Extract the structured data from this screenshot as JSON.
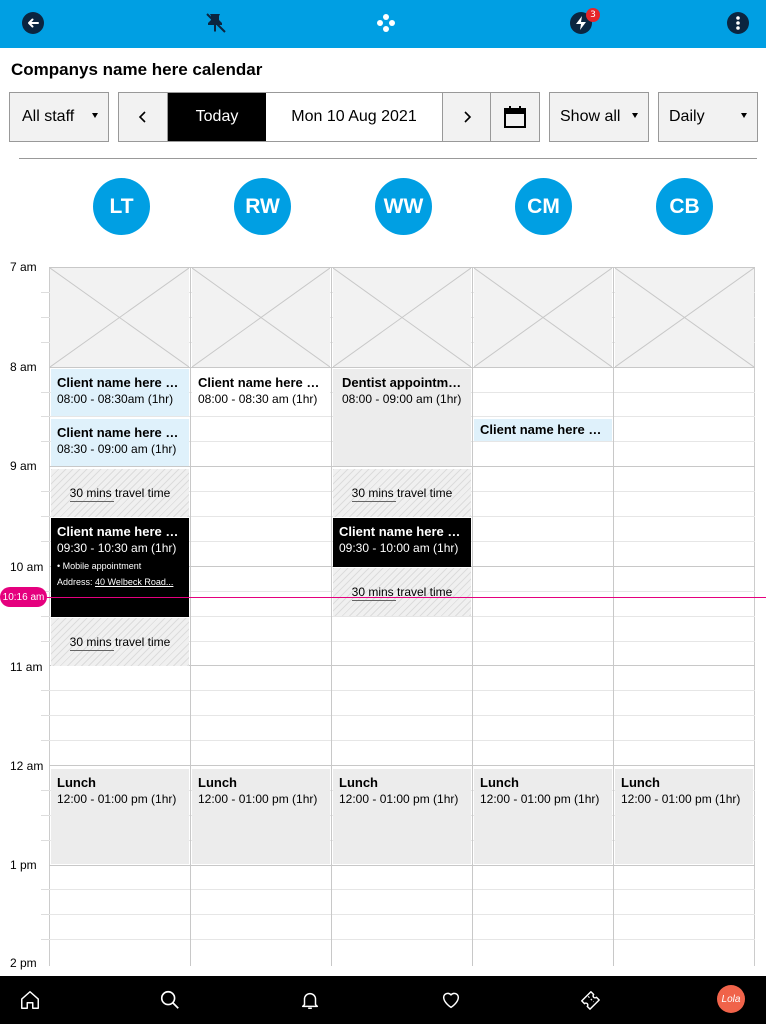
{
  "topbar": {
    "icons": [
      "back-icon",
      "pin-off-icon",
      "apps-icon",
      "bolt-chat-icon",
      "more-vertical-icon"
    ],
    "notification_count": "3"
  },
  "page_title": "Companys name here calendar",
  "controls": {
    "staff_filter": "All staff",
    "prev_label": "‹",
    "today_label": "Today",
    "date_label": "Mon 10 Aug 2021",
    "next_label": "›",
    "show_filter": "Show all",
    "view_filter": "Daily"
  },
  "staff": [
    {
      "initials": "LT"
    },
    {
      "initials": "RW"
    },
    {
      "initials": "WW"
    },
    {
      "initials": "CM"
    },
    {
      "initials": "CB"
    }
  ],
  "hours": [
    "7  am",
    "8  am",
    "9 am",
    "10 am",
    "11 am",
    "12 am",
    "1 pm",
    "2 pm"
  ],
  "now_label": "10:16 am",
  "events": {
    "lt_1": {
      "title": "Client name here name",
      "time": "08:00 - 08:30am (1hr)"
    },
    "lt_2": {
      "title": "Client name here name",
      "time": "08:30 - 09:00 am  (1hr)"
    },
    "lt_travel_1": "30 mins travel time",
    "lt_3": {
      "title": "Client name here name",
      "time": "09:30 - 10:30 am  (1hr)",
      "note": "• Mobile appointment",
      "address_label": "Address: ",
      "address": "40 Welbeck Road..."
    },
    "lt_travel_2": "30 mins travel time",
    "rw_1": {
      "title": "Client name here name",
      "time": "08:00 - 08:30 am  (1hr)"
    },
    "ww_1": {
      "title": "Dentist appointment",
      "time": "08:00 - 09:00 am  (1hr)"
    },
    "ww_travel_1": "30 mins travel time",
    "ww_2": {
      "title": "Client name here name",
      "time": "09:30 - 10:00 am  (1hr)"
    },
    "ww_travel_2": "30 mins travel time",
    "cm_1": {
      "title": "Client name here name"
    }
  },
  "lunch": {
    "title": "Lunch",
    "time": "12:00 - 01:00 pm  (1hr)"
  },
  "bottombar": {
    "icons": [
      "home-icon",
      "search-icon",
      "bell-icon",
      "heart-icon",
      "ticket-icon"
    ],
    "lola_label": "Lola"
  }
}
